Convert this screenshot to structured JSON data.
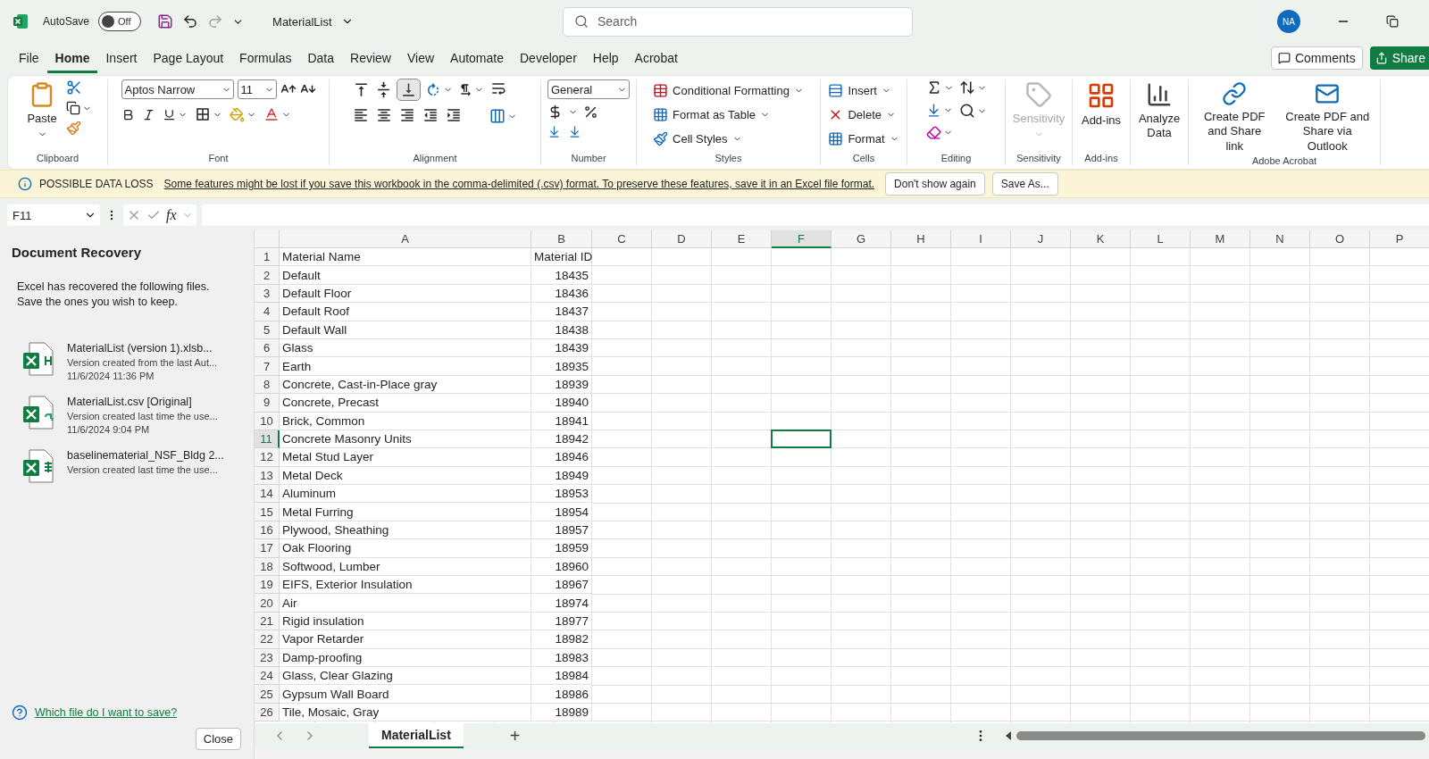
{
  "title_bar": {
    "autosave": {
      "label": "AutoSave",
      "on": false,
      "state": "Off"
    },
    "file_name": "MaterialList",
    "search": {
      "placeholder": "Search"
    },
    "user": {
      "initials": "NA"
    }
  },
  "menu_tabs": [
    {
      "label": "File",
      "selected": false
    },
    {
      "label": "Home",
      "selected": true
    },
    {
      "label": "Insert",
      "selected": false
    },
    {
      "label": "Page Layout",
      "selected": false
    },
    {
      "label": "Formulas",
      "selected": false
    },
    {
      "label": "Data",
      "selected": false
    },
    {
      "label": "Review",
      "selected": false
    },
    {
      "label": "View",
      "selected": false
    },
    {
      "label": "Automate",
      "selected": false
    },
    {
      "label": "Developer",
      "selected": false
    },
    {
      "label": "Help",
      "selected": false
    },
    {
      "label": "Acrobat",
      "selected": false
    }
  ],
  "header_buttons": {
    "comments": "Comments",
    "share": "Share"
  },
  "ribbon": [
    {
      "kind": "clipboard",
      "label": "Clipboard",
      "paste": "Paste"
    },
    {
      "kind": "font",
      "label": "Font",
      "font": "Aptos Narrow",
      "size": "11"
    },
    {
      "kind": "alignment",
      "label": "Alignment"
    },
    {
      "kind": "number",
      "label": "Number",
      "format": "General"
    },
    {
      "kind": "styles",
      "label": "Styles",
      "items": [
        "Conditional Formatting",
        "Format as Table",
        "Cell Styles"
      ]
    },
    {
      "kind": "cells",
      "label": "Cells",
      "items": [
        "Insert",
        "Delete",
        "Format"
      ]
    },
    {
      "kind": "editing",
      "label": "Editing"
    },
    {
      "kind": "sensitivity",
      "label": "Sensitivity",
      "button": "Sensitivity",
      "disabled": true
    },
    {
      "kind": "addins",
      "label": "Add-ins",
      "button": "Add-ins"
    },
    {
      "kind": "analyze",
      "button": "Analyze Data"
    },
    {
      "kind": "acrobat",
      "label": "Adobe Acrobat",
      "buttons": [
        "Create PDF and Share link",
        "Create PDF and Share via Outlook"
      ]
    }
  ],
  "notification": {
    "title": "POSSIBLE DATA LOSS",
    "message": "Some features might be lost if you save this workbook in the comma-delimited (.csv) format. To preserve these features, save it in an Excel file format.",
    "buttons": [
      "Don't show again",
      "Save As..."
    ]
  },
  "formula_bar": {
    "name_box": "F11",
    "fx": "fx"
  },
  "recovery_panel": {
    "title": "Document Recovery",
    "description": [
      "Excel has recovered the following files.",
      "Save the ones you wish to keep."
    ],
    "files": [
      {
        "kind": "xlsb",
        "name": "MaterialList (version 1).xlsb...",
        "note": "Version created from the last Aut...",
        "time": "11/6/2024 11:36 PM"
      },
      {
        "kind": "csv",
        "name": "MaterialList.csv  [Original]",
        "note": "Version created last time the use...",
        "time": "11/6/2024 9:04 PM"
      },
      {
        "kind": "xlsx",
        "name": "baselinematerial_NSF_Bldg 2...",
        "note": "Version created last time the use..."
      }
    ],
    "help_link": "Which file do I want to save?",
    "close": "Close"
  },
  "sheet": {
    "columns": [
      {
        "label": "A",
        "selected": false
      },
      {
        "label": "B",
        "selected": false
      },
      {
        "label": "C",
        "selected": false
      },
      {
        "label": "D",
        "selected": false
      },
      {
        "label": "E",
        "selected": false
      },
      {
        "label": "F",
        "selected": true
      },
      {
        "label": "G",
        "selected": false
      },
      {
        "label": "H",
        "selected": false
      },
      {
        "label": "I",
        "selected": false
      },
      {
        "label": "J",
        "selected": false
      },
      {
        "label": "K",
        "selected": false
      },
      {
        "label": "L",
        "selected": false
      },
      {
        "label": "M",
        "selected": false
      },
      {
        "label": "N",
        "selected": false
      },
      {
        "label": "O",
        "selected": false
      },
      {
        "label": "P",
        "selected": false
      }
    ],
    "rows": [
      {
        "number": "1",
        "selected": false,
        "cells": [
          {
            "value": "Material Name",
            "kind": "text"
          },
          {
            "value": "Material ID",
            "kind": "text"
          }
        ]
      },
      {
        "number": "2",
        "selected": false,
        "cells": [
          {
            "value": "Default",
            "kind": "text"
          },
          {
            "value": "18435",
            "kind": "number"
          }
        ]
      },
      {
        "number": "3",
        "selected": false,
        "cells": [
          {
            "value": "Default Floor",
            "kind": "text"
          },
          {
            "value": "18436",
            "kind": "number"
          }
        ]
      },
      {
        "number": "4",
        "selected": false,
        "cells": [
          {
            "value": "Default Roof",
            "kind": "text"
          },
          {
            "value": "18437",
            "kind": "number"
          }
        ]
      },
      {
        "number": "5",
        "selected": false,
        "cells": [
          {
            "value": "Default Wall",
            "kind": "text"
          },
          {
            "value": "18438",
            "kind": "number"
          }
        ]
      },
      {
        "number": "6",
        "selected": false,
        "cells": [
          {
            "value": "Glass",
            "kind": "text"
          },
          {
            "value": "18439",
            "kind": "number"
          }
        ]
      },
      {
        "number": "7",
        "selected": false,
        "cells": [
          {
            "value": "Earth",
            "kind": "text"
          },
          {
            "value": "18935",
            "kind": "number"
          }
        ]
      },
      {
        "number": "8",
        "selected": false,
        "cells": [
          {
            "value": "Concrete, Cast-in-Place gray",
            "kind": "text"
          },
          {
            "value": "18939",
            "kind": "number"
          }
        ]
      },
      {
        "number": "9",
        "selected": false,
        "cells": [
          {
            "value": "Concrete, Precast",
            "kind": "text"
          },
          {
            "value": "18940",
            "kind": "number"
          }
        ]
      },
      {
        "number": "10",
        "selected": false,
        "cells": [
          {
            "value": "Brick, Common",
            "kind": "text"
          },
          {
            "value": "18941",
            "kind": "number"
          }
        ]
      },
      {
        "number": "11",
        "selected": true,
        "cells": [
          {
            "value": "Concrete Masonry Units",
            "kind": "text"
          },
          {
            "value": "18942",
            "kind": "number"
          }
        ]
      },
      {
        "number": "12",
        "selected": false,
        "cells": [
          {
            "value": "Metal Stud Layer",
            "kind": "text"
          },
          {
            "value": "18946",
            "kind": "number"
          }
        ]
      },
      {
        "number": "13",
        "selected": false,
        "cells": [
          {
            "value": "Metal Deck",
            "kind": "text"
          },
          {
            "value": "18949",
            "kind": "number"
          }
        ]
      },
      {
        "number": "14",
        "selected": false,
        "cells": [
          {
            "value": "Aluminum",
            "kind": "text"
          },
          {
            "value": "18953",
            "kind": "number"
          }
        ]
      },
      {
        "number": "15",
        "selected": false,
        "cells": [
          {
            "value": "Metal Furring",
            "kind": "text"
          },
          {
            "value": "18954",
            "kind": "number"
          }
        ]
      },
      {
        "number": "16",
        "selected": false,
        "cells": [
          {
            "value": "Plywood, Sheathing",
            "kind": "text"
          },
          {
            "value": "18957",
            "kind": "number"
          }
        ]
      },
      {
        "number": "17",
        "selected": false,
        "cells": [
          {
            "value": "Oak Flooring",
            "kind": "text"
          },
          {
            "value": "18959",
            "kind": "number"
          }
        ]
      },
      {
        "number": "18",
        "selected": false,
        "cells": [
          {
            "value": "Softwood, Lumber",
            "kind": "text"
          },
          {
            "value": "18960",
            "kind": "number"
          }
        ]
      },
      {
        "number": "19",
        "selected": false,
        "cells": [
          {
            "value": "EIFS, Exterior Insulation",
            "kind": "text"
          },
          {
            "value": "18967",
            "kind": "number"
          }
        ]
      },
      {
        "number": "20",
        "selected": false,
        "cells": [
          {
            "value": "Air",
            "kind": "text"
          },
          {
            "value": "18974",
            "kind": "number"
          }
        ]
      },
      {
        "number": "21",
        "selected": false,
        "cells": [
          {
            "value": "Rigid insulation",
            "kind": "text"
          },
          {
            "value": "18977",
            "kind": "number"
          }
        ]
      },
      {
        "number": "22",
        "selected": false,
        "cells": [
          {
            "value": "Vapor Retarder",
            "kind": "text"
          },
          {
            "value": "18982",
            "kind": "number"
          }
        ]
      },
      {
        "number": "23",
        "selected": false,
        "cells": [
          {
            "value": "Damp-proofing",
            "kind": "text"
          },
          {
            "value": "18983",
            "kind": "number"
          }
        ]
      },
      {
        "number": "24",
        "selected": false,
        "cells": [
          {
            "value": "Glass, Clear Glazing",
            "kind": "text"
          },
          {
            "value": "18984",
            "kind": "number"
          }
        ]
      },
      {
        "number": "25",
        "selected": false,
        "cells": [
          {
            "value": "Gypsum Wall Board",
            "kind": "text"
          },
          {
            "value": "18986",
            "kind": "number"
          }
        ]
      },
      {
        "number": "26",
        "selected": false,
        "cells": [
          {
            "value": "Tile, Mosaic, Gray",
            "kind": "text"
          },
          {
            "value": "18989",
            "kind": "number"
          }
        ]
      }
    ]
  },
  "sheet_tabs": [
    {
      "label": "MaterialList",
      "selected": true
    }
  ],
  "add_sheet": "+"
}
